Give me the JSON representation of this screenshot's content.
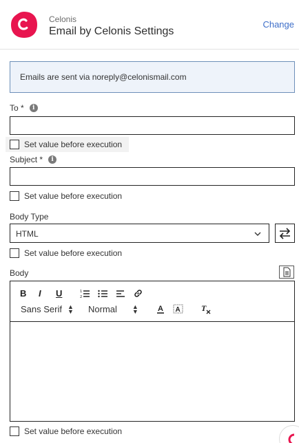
{
  "header": {
    "app_name": "Celonis",
    "title": "Email by Celonis Settings",
    "change_label": "Change",
    "logo_letter": "C",
    "logo_color": "#e8154f"
  },
  "info": {
    "message": "Emails are sent via noreply@celonismail.com"
  },
  "fields": {
    "to": {
      "label": "To *",
      "value": ""
    },
    "subject": {
      "label": "Subject *",
      "value": ""
    },
    "body_type": {
      "label": "Body Type",
      "value": "HTML"
    },
    "body": {
      "label": "Body"
    }
  },
  "checkbox_label": "Set value before execution",
  "editor": {
    "bold": "B",
    "italic": "I",
    "underline": "U",
    "font_family": "Sans Serif",
    "font_size": "Normal"
  },
  "colors": {
    "accent": "#3d6ec9",
    "info_bg": "#eef3fa",
    "info_border": "#6c8fb8"
  }
}
